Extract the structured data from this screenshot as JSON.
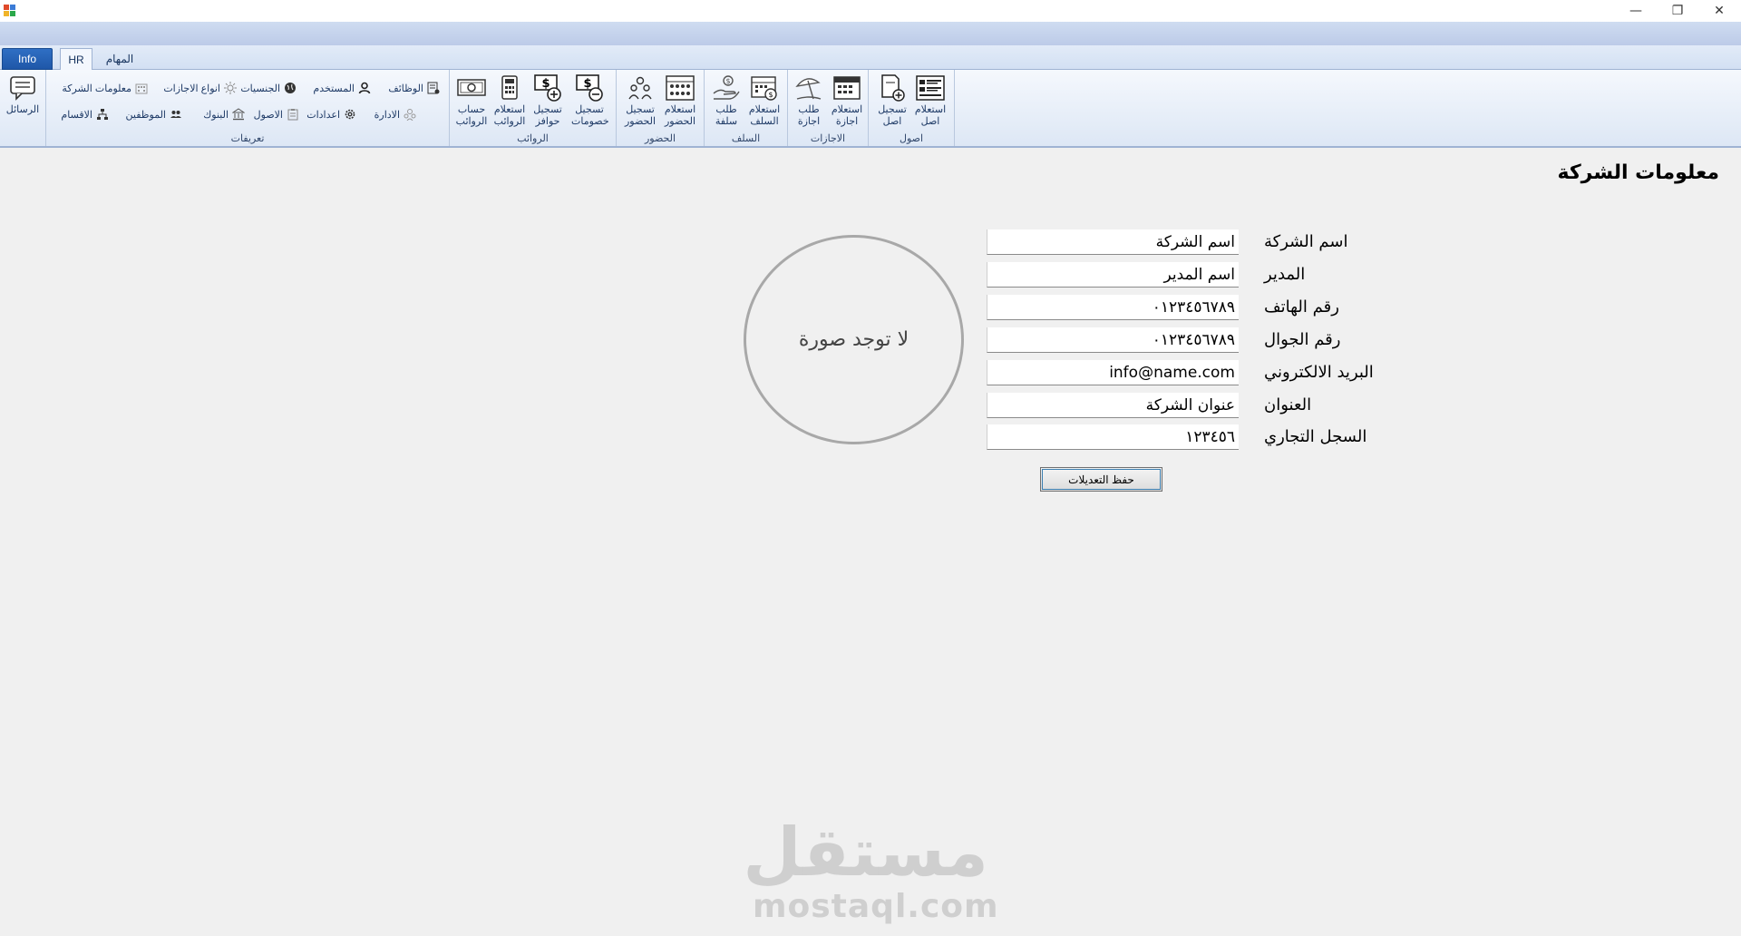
{
  "window": {
    "controls": {
      "minimize": "—",
      "restore": "❐",
      "close": "✕"
    }
  },
  "ribbon": {
    "tabs": [
      {
        "label": "Info"
      },
      {
        "label": "HR"
      },
      {
        "label": "المهام"
      }
    ],
    "messages_button": "الرسائل",
    "groups": {
      "definitions": {
        "label": "تعريفات",
        "items": {
          "jobs": "الوظائف",
          "user": "المستخدم",
          "nationalities": "الجنسيات",
          "leave_types": "انواع الاجازات",
          "company_info": "معلومات الشركة",
          "administration": "الادارة",
          "settings": "اعدادات",
          "assets": "الاصول",
          "banks": "البنوك",
          "employees": "الموظفين",
          "departments": "الاقسام"
        }
      },
      "salaries": {
        "label": "الروائب",
        "items": {
          "deductions_1": "تسجيل",
          "deductions_2": "خصومات",
          "incentives_1": "تسجيل",
          "incentives_2": "حوافز",
          "inquiry_1": "استعلام",
          "inquiry_2": "الروائب",
          "calc_1": "حساب",
          "calc_2": "الروائب"
        }
      },
      "attendance": {
        "label": "الحضور",
        "items": {
          "inquiry_1": "استعلام",
          "inquiry_2": "الحضور",
          "register_1": "تسجيل",
          "register_2": "الحضور"
        }
      },
      "advances": {
        "label": "السلف",
        "items": {
          "inquiry_1": "استعلام",
          "inquiry_2": "السلف",
          "request_1": "طلب",
          "request_2": "سلفة"
        }
      },
      "leaves": {
        "label": "الاجازات",
        "items": {
          "inquiry_1": "استعلام",
          "inquiry_2": "اجازة",
          "request_1": "طلب",
          "request_2": "اجازة"
        }
      },
      "assets": {
        "label": "اصول",
        "items": {
          "inquiry_1": "استعلام",
          "inquiry_2": "اصل",
          "register_1": "تسجيل",
          "register_2": "اصل"
        }
      }
    }
  },
  "main": {
    "title": "معلومات الشركة",
    "fields": [
      {
        "label": "اسم الشركة",
        "value": "اسم الشركة"
      },
      {
        "label": "المدير",
        "value": "اسم المدير"
      },
      {
        "label": "رقم الهاتف",
        "value": "٠١٢٣٤٥٦٧٨٩"
      },
      {
        "label": "رقم الجوال",
        "value": "٠١٢٣٤٥٦٧٨٩"
      },
      {
        "label": "البريد الالكتروني",
        "value": "info@name.com"
      },
      {
        "label": "العنوان",
        "value": "عنوان الشركة"
      },
      {
        "label": "السجل التجاري",
        "value": "١٢٣٤٥٦"
      }
    ],
    "photo_placeholder": "لا توجد صورة",
    "save_button": "حفظ التعديلات"
  },
  "watermark": {
    "arabic": "مستقل",
    "latin": "mostaql.com"
  }
}
